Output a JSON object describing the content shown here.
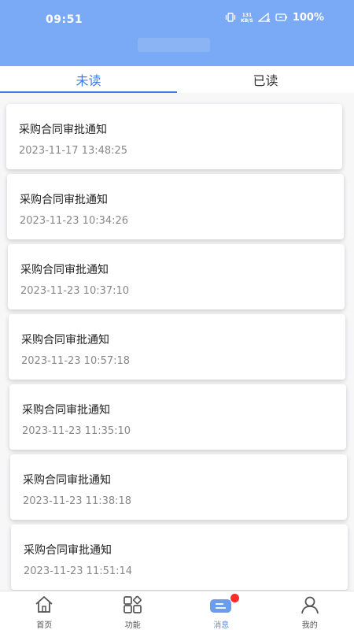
{
  "status_bar": {
    "time": "09:51",
    "net_speed_value": "131",
    "net_speed_unit": "KB/S",
    "battery": "100%"
  },
  "tabs": [
    {
      "label": "未读",
      "active": true
    },
    {
      "label": "已读",
      "active": false
    }
  ],
  "messages": [
    {
      "title": "采购合同审批通知",
      "time": "2023-11-17 13:48:25"
    },
    {
      "title": "采购合同审批通知",
      "time": "2023-11-23 10:34:26"
    },
    {
      "title": "采购合同审批通知",
      "time": "2023-11-23 10:37:10"
    },
    {
      "title": "采购合同审批通知",
      "time": "2023-11-23 10:57:18"
    },
    {
      "title": "采购合同审批通知",
      "time": "2023-11-23 11:35:10"
    },
    {
      "title": "采购合同审批通知",
      "time": "2023-11-23 11:38:18"
    },
    {
      "title": "采购合同审批通知",
      "time": "2023-11-23 11:51:14"
    }
  ],
  "bottom_nav": [
    {
      "label": "首页",
      "icon": "home-icon",
      "active": false
    },
    {
      "label": "功能",
      "icon": "apps-icon",
      "active": false
    },
    {
      "label": "消息",
      "icon": "message-icon",
      "active": true,
      "badge": true
    },
    {
      "label": "我的",
      "icon": "user-icon",
      "active": false
    }
  ],
  "colors": {
    "header": "#7aaaf5",
    "accent": "#3c7de6",
    "badge": "#ff2a2a"
  }
}
